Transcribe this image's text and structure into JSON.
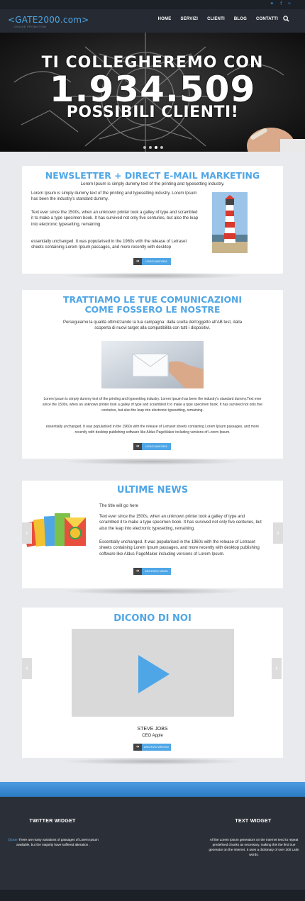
{
  "topbar": {
    "social": [
      "t",
      "f",
      "rss"
    ]
  },
  "nav": {
    "logo": "<GATE2000.com>",
    "logo_sub": "ONLINE PROMOTION",
    "menu": [
      "HOME",
      "SERVIZI",
      "CLIENTI",
      "BLOG",
      "CONTATTI"
    ]
  },
  "hero": {
    "line1": "TI COLLEGHEREMO CON",
    "line2": "1.934.509",
    "line3": "POSSIBILI CLIENTI!",
    "slides": 4,
    "active_slide": 3
  },
  "newsletter": {
    "title": "NEWSLETTER + DIRECT E-MAIL MARKETING",
    "subtitle": "Lorem Ipsum is simply dummy text of the printing and typesetting industry.",
    "p1": "Lorem Ipsum is simply dummy text of the printing and typesetting industry. Lorem Ipsum has been the industry's standard dummy.",
    "p2": "Text ever since the 1500s, when an unknown printer took a galley of type and scrambled it to make a type specimen book. It has survived not only five centuries, but also the leap into electronic typesetting, remaining.",
    "p3": "essentially unchanged. It was popularised in the 1960s with the release of Letraset sheets containing Lorem Ipsum passages, and more recently with desktop",
    "button": "LEGGI ANCORA"
  },
  "trattiamo": {
    "title1": "TRATTIAMO LE TUE COMUNICAZIONI",
    "title2": "COME FOSSERO LE NOSTRE",
    "intro": "Perseguiamo la qualità ottimizzando la tua campagna: dalla scelta dell'oggetto all'AB test, dalla scoperta di nuovi target alla compatibilità con tutti i dispositivi.",
    "p1": "Lorem Ipsum is simply dummy text of the printing and typesetting industry. Lorem Ipsum has been the industry's standard dummy.Text ever since the 1500s, when an unknown printer took a galley of type and scrambled it to make a type specimen book. It has survived not only five centuries, but also the leap into electronic typesetting, remaining.",
    "p2": "essentially unchanged. It was popularised in the 1960s with the release of Letraset sheets containing Lorem Ipsum passages, and more recently with desktop publishing software like Aldus PageMaker including versions of Lorem Ipsum.",
    "button": "LEGGI ANCORA"
  },
  "news": {
    "title": "ULTIME NEWS",
    "post_title": "The title will go here",
    "p1": "Text ever since the 1500s, when an unknown printer took a galley of type and scrambled it to make a type specimen book. It has survived not only five centuries, but also the leap into electronic typesetting, remaining.",
    "p2": "Essentially unchanged. It was popularised in the 1960s with the release of Letraset sheets containing Lorem Ipsum passages, and more recently with desktop publishing software like Aldus PageMaker including versions of Lorem Ipsum.",
    "button": "ARCHIVIO NEWS"
  },
  "testimonials": {
    "title": "DICONO DI NOI",
    "name": "STEVE JOBS",
    "role": "CEO Apple",
    "button": "ARCHIVIO ARCHIV"
  },
  "footer": {
    "twitter_title": "TWITTER WIDGET",
    "twitter_handle": "@user",
    "twitter_text": "There are many variations of passages of Lorem Ipsum available, but the majority have suffered alteration .",
    "text_title": "TEXT WIDGET",
    "text_body": "All the Lorem Ipsum generators on the Internet tend to repeat predefined chunks as necessary, making this the first true generator on the Internet. It uses a dictionary of over 200 Latin words."
  },
  "colors": {
    "accent": "#4fa6e6",
    "dark": "#262b33",
    "footer": "#2b3038",
    "page": "#e8eaed"
  }
}
